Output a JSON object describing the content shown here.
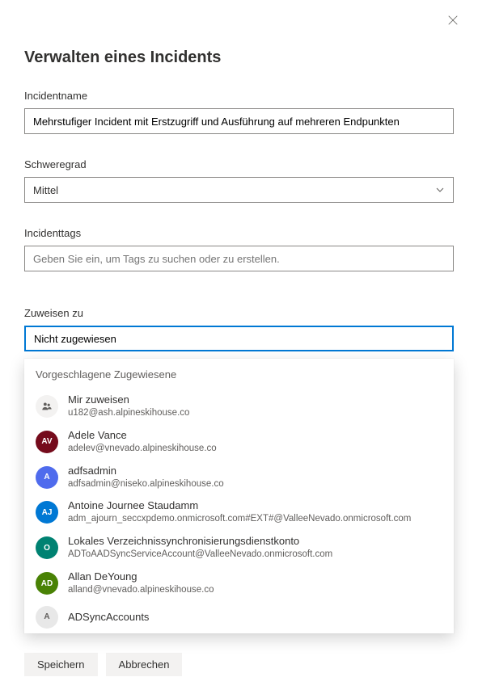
{
  "header": {
    "title": "Verwalten eines Incidents"
  },
  "fields": {
    "incident_name": {
      "label": "Incidentname",
      "value": "Mehrstufiger Incident mit Erstzugriff und Ausführung auf mehreren Endpunkten"
    },
    "severity": {
      "label": "Schweregrad",
      "value": "Mittel"
    },
    "tags": {
      "label": "Incidenttags",
      "placeholder": "Geben Sie ein, um Tags zu suchen oder zu erstellen."
    },
    "assign_to": {
      "label": "Zuweisen zu",
      "value": "Nicht zugewiesen"
    }
  },
  "assign_dropdown": {
    "header": "Vorgeschlagene Zugewiesene",
    "items": [
      {
        "name": "Mir zuweisen",
        "email": "u182@ash.alpineskihouse.co",
        "initials": "",
        "icon": "people",
        "color": "#f3f2f1"
      },
      {
        "name": "Adele Vance",
        "email": "adelev@vnevado.alpineskihouse.co",
        "initials": "AV",
        "color": "#750b1c"
      },
      {
        "name": "adfsadmin",
        "email": "adfsadmin@niseko.alpineskihouse.co",
        "initials": "A",
        "color": "#4f6bed"
      },
      {
        "name": "Antoine Journee Staudamm",
        "email": "adm_ajourn_seccxpdemo.onmicrosoft.com#EXT#@ValleeNevado.onmicrosoft.com",
        "initials": "AJ",
        "color": "#0078d4"
      },
      {
        "name": "Lokales Verzeichnissynchronisierungsdienstkonto",
        "email": "ADToAADSyncServiceAccount@ValleeNevado.onmicrosoft.com",
        "initials": "O",
        "color": "#008272"
      },
      {
        "name": "Allan DeYoung",
        "email": "alland@vnevado.alpineskihouse.co",
        "initials": "AD",
        "color": "#498205"
      },
      {
        "name": "ADSyncAccounts",
        "email": "",
        "initials": "A",
        "color": "#e8e8e8"
      }
    ]
  },
  "footer": {
    "save_label": "Speichern",
    "cancel_label": "Abbrechen"
  }
}
